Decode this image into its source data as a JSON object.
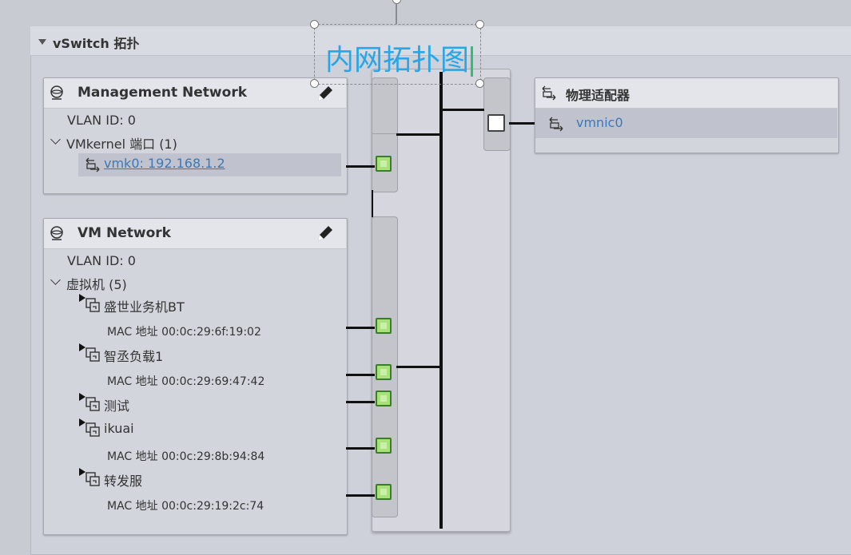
{
  "panel": {
    "title": "vSwitch 拓扑"
  },
  "callout": {
    "text": "内网拓扑图"
  },
  "management_network": {
    "title": "Management Network",
    "vlan": "VLAN ID: 0",
    "group_label": "VMkernel 端口 (1)",
    "vmk": "vmk0: 192.168.1.2"
  },
  "vm_network": {
    "title": "VM Network",
    "vlan": "VLAN ID: 0",
    "group_label": "虚拟机 (5)",
    "vms": [
      {
        "name": "盛世业务机BT",
        "mac": "MAC 地址 00:0c:29:6f:19:02"
      },
      {
        "name": "智丞负载1",
        "mac": "MAC 地址 00:0c:29:69:47:42"
      },
      {
        "name": "测试",
        "mac": ""
      },
      {
        "name": "ikuai",
        "mac": "MAC 地址 00:0c:29:8b:94:84"
      },
      {
        "name": "转发服",
        "mac": "MAC 地址 00:0c:29:19:2c:74"
      }
    ]
  },
  "physical_adapters": {
    "title": "物理适配器",
    "items": [
      "vmnic0"
    ]
  },
  "icons": {
    "network": "network-globe-icon",
    "edit": "pencil-icon",
    "adapter": "adapter-icon",
    "vm": "vm-icon"
  }
}
